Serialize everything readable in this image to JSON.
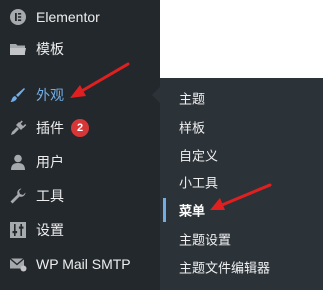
{
  "sidebar": {
    "items": [
      {
        "label": "Elementor",
        "icon": "elementor-icon"
      },
      {
        "label": "模板",
        "icon": "folder-icon"
      },
      {
        "label": "外观",
        "icon": "paintbrush-icon",
        "active": true
      },
      {
        "label": "插件",
        "icon": "plugin-icon",
        "badge": "2"
      },
      {
        "label": "用户",
        "icon": "user-icon"
      },
      {
        "label": "工具",
        "icon": "wrench-icon"
      },
      {
        "label": "设置",
        "icon": "settings-icon"
      },
      {
        "label": "WP Mail SMTP",
        "icon": "mail-icon"
      }
    ]
  },
  "submenu": {
    "items": [
      {
        "label": "主题"
      },
      {
        "label": "样板"
      },
      {
        "label": "自定义"
      },
      {
        "label": "小工具"
      },
      {
        "label": "菜单",
        "current": true
      },
      {
        "label": "主题设置"
      },
      {
        "label": "主题文件编辑器"
      }
    ]
  },
  "colors": {
    "sidebar_bg": "#23282d",
    "submenu_bg": "#2c3338",
    "accent": "#72aee6",
    "badge": "#d63638",
    "annotation_arrow": "#e02020"
  }
}
